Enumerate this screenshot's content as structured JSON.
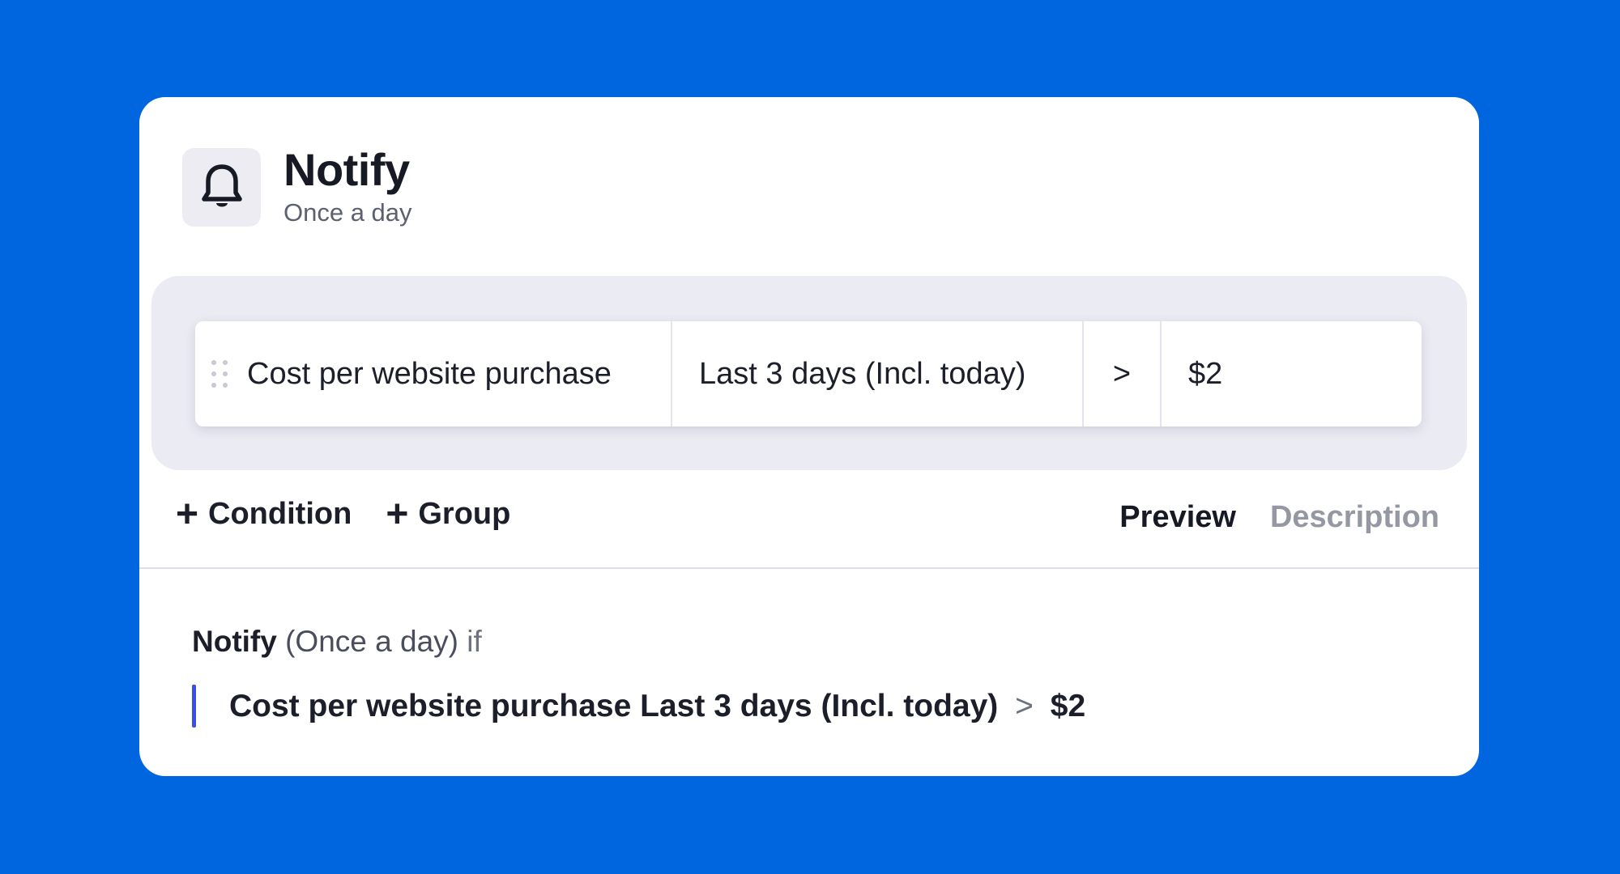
{
  "colors": {
    "background": "#0066e0",
    "card": "#ffffff",
    "condition_area": "#ebebf3",
    "accent_bar": "#3d4ee8"
  },
  "header": {
    "icon": "bell-icon",
    "title": "Notify",
    "subtitle": "Once a day"
  },
  "condition": {
    "drag_icon": "drag-handle-icon",
    "metric": "Cost per website purchase",
    "period": "Last 3 days (Incl. today)",
    "operator": ">",
    "value": "$2"
  },
  "actions": {
    "add_condition_label": "Condition",
    "add_group_label": "Group",
    "plus_icon": "plus-icon"
  },
  "tabs": [
    {
      "label": "Preview",
      "active": true
    },
    {
      "label": "Description",
      "active": false
    }
  ],
  "summary": {
    "action": "Notify",
    "frequency": "(Once a day)",
    "connector": "if",
    "metric": "Cost per website purchase",
    "period": "Last 3 days (Incl. today)",
    "operator": ">",
    "value": "$2"
  }
}
